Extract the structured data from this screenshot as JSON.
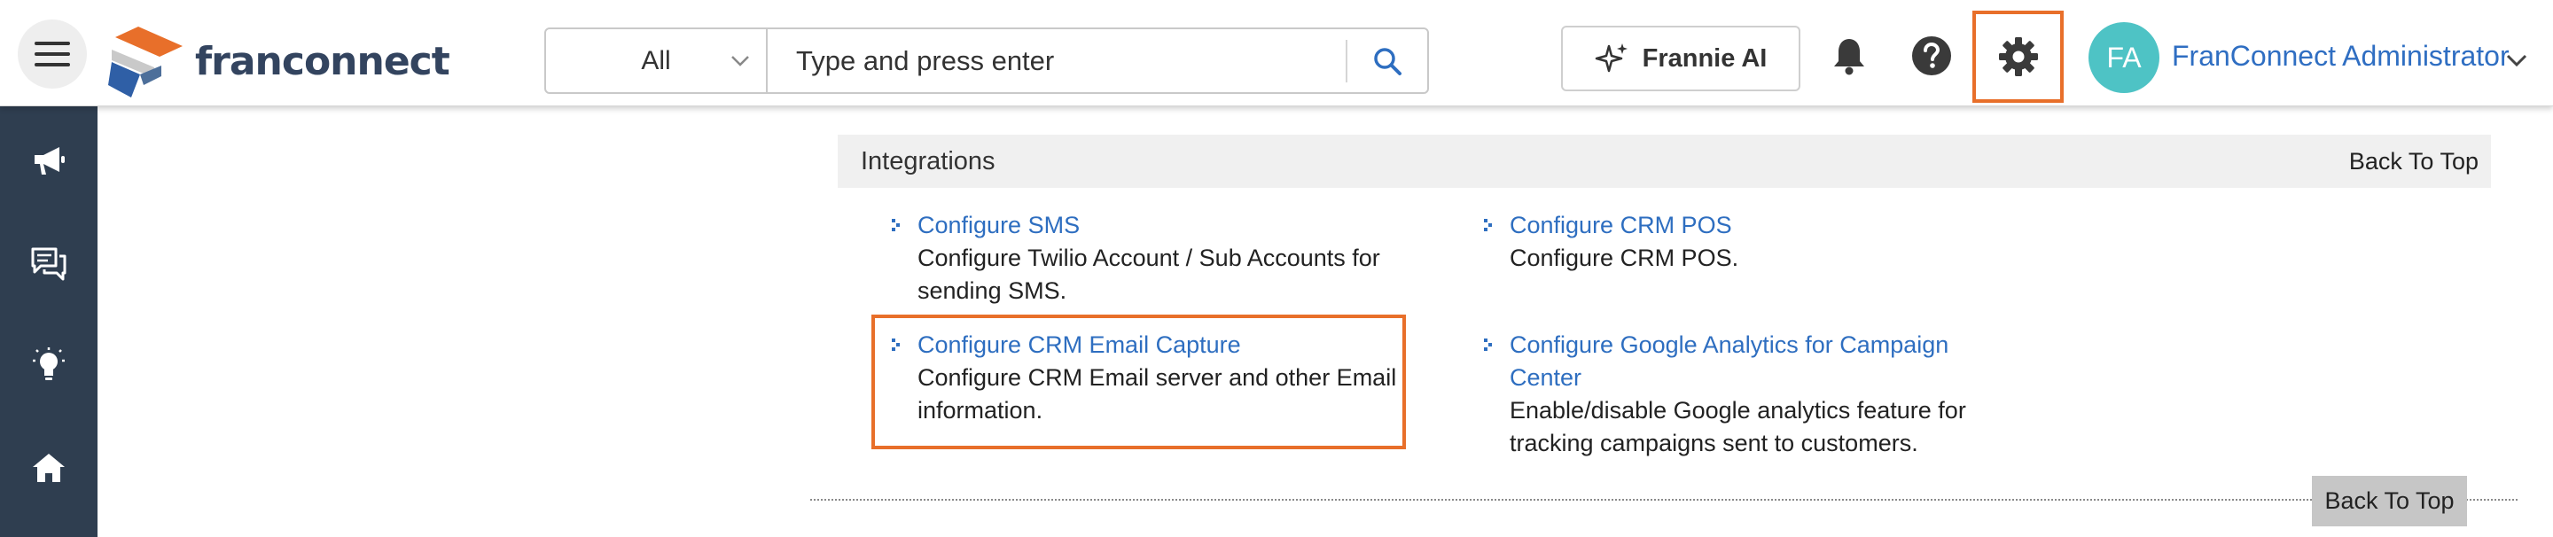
{
  "header": {
    "logo_text": "franconnect",
    "search": {
      "scope": "All",
      "placeholder": "Type and press enter"
    },
    "frannie_label": "Frannie AI",
    "user": {
      "initials": "FA",
      "name": "FranConnect Administrator"
    }
  },
  "section": {
    "title": "Integrations",
    "back_to_top": "Back To Top"
  },
  "items": [
    {
      "link": "Configure SMS",
      "desc_lines": [
        "Configure Twilio Account / Sub Accounts for",
        "sending SMS."
      ]
    },
    {
      "link": "Configure CRM POS",
      "desc_lines": [
        "Configure CRM POS."
      ]
    },
    {
      "link": "Configure CRM Email Capture",
      "desc_lines": [
        "Configure CRM Email server and other Email",
        "information."
      ]
    },
    {
      "link_lines": [
        "Configure Google Analytics for Campaign",
        "Center"
      ],
      "desc_lines": [
        "Enable/disable Google analytics feature for",
        "tracking campaigns sent to customers."
      ]
    }
  ],
  "footer": {
    "back_to_top_button": "Back To Top"
  },
  "colors": {
    "accent_link": "#2e6ec0",
    "highlight": "#e86f2a",
    "sidebar": "#2f3e50",
    "avatar": "#4ec3c5"
  },
  "icons": {
    "sidebar": [
      "megaphone-icon",
      "chat-icon",
      "lightbulb-icon",
      "home-icon"
    ],
    "header": [
      "menu-icon",
      "search-icon",
      "sparkle-icon",
      "bell-icon",
      "help-icon",
      "gear-icon",
      "chevron-down-icon"
    ]
  }
}
